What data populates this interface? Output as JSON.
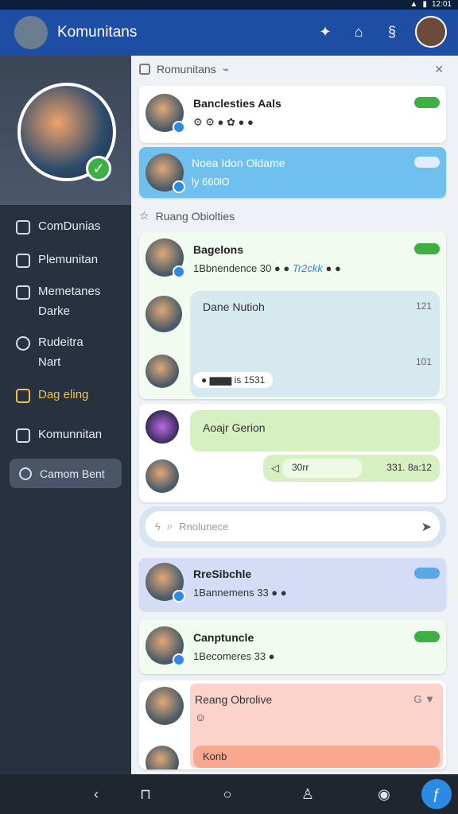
{
  "status": {
    "time": "12:01"
  },
  "header": {
    "title": "Komunitans"
  },
  "breadcrumb": {
    "label": "Romunitans"
  },
  "sidebar": {
    "items": [
      {
        "label": "ComDunias"
      },
      {
        "label": "Plemunitan"
      },
      {
        "label": "Memetanes",
        "sub": "Darke"
      },
      {
        "label": "Rudeitra",
        "sub": "Nart"
      },
      {
        "label": "Dag eling"
      },
      {
        "label": "Komunnitan"
      }
    ],
    "button": "Camom Bent"
  },
  "section_label": "Ruang Obiolties",
  "cards": {
    "c1": {
      "name": "Banclesties Aals"
    },
    "c2": {
      "name": "Noea Idon Oldame",
      "sub": "ly 660lO"
    },
    "c3": {
      "name": "Bagelons",
      "sub": "1Bbnendence 30",
      "tag": "Tr2ckk"
    },
    "c3b": {
      "bubble_text": "Dane Nutioh",
      "time1": "121",
      "time2": "101",
      "chip": "is 1531"
    },
    "c4": {
      "bubble_text": "Aoajr Gerion",
      "reply": "30rr",
      "time": "331. 8a:12"
    },
    "c5": {
      "name": "RreSibchle",
      "sub": "1Bannemens 33"
    },
    "c6": {
      "name": "Canptuncle",
      "sub": "1Becomeres 33"
    },
    "c7": {
      "name": "Reang Obrolive",
      "bottom": "Konb"
    }
  },
  "search": {
    "placeholder": "Rnolunece"
  },
  "colors": {
    "accent": "#1d4ea3",
    "green": "#3cb043",
    "blue": "#2b8ae6",
    "highlight": "#f2c14a"
  }
}
